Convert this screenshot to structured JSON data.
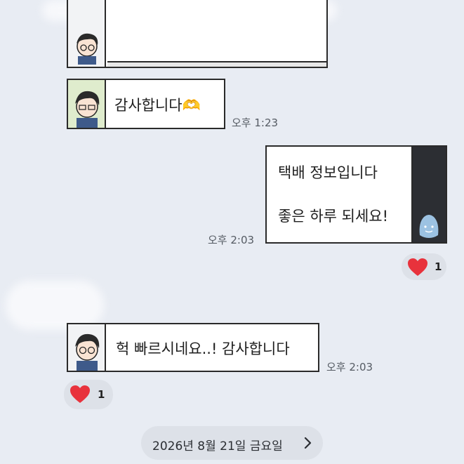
{
  "messages": [
    {
      "id": "m1",
      "direction": "incoming",
      "text": "",
      "time": "",
      "redacted": true
    },
    {
      "id": "m2",
      "direction": "incoming",
      "text": "감사합니다🫶",
      "time": "오후 1:23"
    },
    {
      "id": "m3",
      "direction": "outgoing",
      "lines": [
        "택배 정보입니다",
        "좋은 하루 되세요!"
      ],
      "time": "오후 2:03",
      "reaction": {
        "icon": "heart-icon",
        "count": "1"
      }
    },
    {
      "id": "m4",
      "direction": "incoming",
      "text": "헉 빠르시네요..! 감사합니다",
      "time": "오후 2:03",
      "reaction": {
        "icon": "heart-icon",
        "count": "1"
      }
    }
  ],
  "date_divider": {
    "label": "2026년 8월 21일 금요일",
    "icon": "chevron-right-icon"
  },
  "colors": {
    "background": "#e8ecf3",
    "heart": "#e8323c",
    "card_dark": "#2c2e33",
    "card_green": "#dfeccd"
  }
}
